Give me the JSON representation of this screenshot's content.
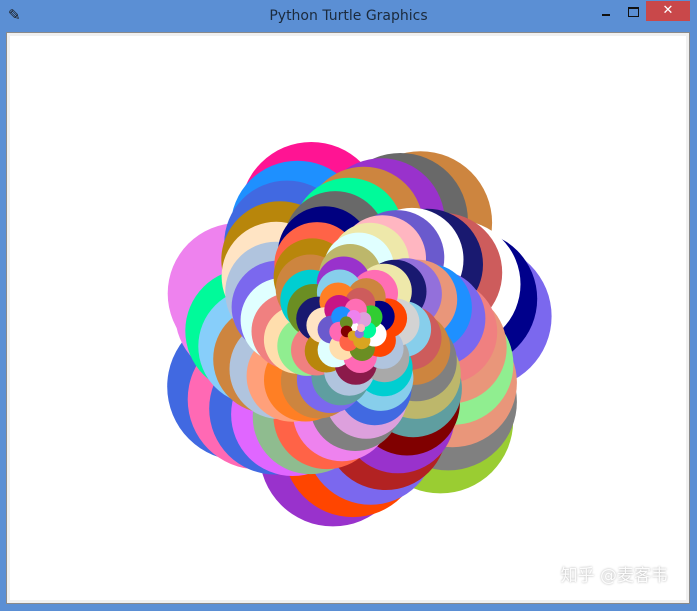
{
  "window": {
    "title": "Python Turtle Graphics",
    "close_glyph": "✕",
    "icons": [
      "feather-icon",
      "minimize-icon",
      "maximize-icon",
      "close-icon"
    ]
  },
  "canvas": {
    "background": "#ffffff",
    "watermark": "知乎 @麦客韦",
    "palette": [
      "#8b1a4a",
      "#6b8e23",
      "#dda0dd",
      "#e066ff",
      "#ee82ee",
      "#ff7f24",
      "#9acd32",
      "#cd5c5c",
      "#ffb6c1",
      "#ffffff",
      "#00fa9a",
      "#87cefa",
      "#a9a9a9",
      "#ff6347",
      "#7b68ee",
      "#ffdead",
      "#191970",
      "#00008b",
      "#228b22",
      "#f08080",
      "#f5f5f5",
      "#b0c4de",
      "#4682b4",
      "#d3d3d3",
      "#808080",
      "#8fbc8f",
      "#cd853f",
      "#e0ffff",
      "#000080",
      "#4169e1",
      "#ff1493",
      "#00ffff",
      "#800000",
      "#9932cc",
      "#ba55d3",
      "#ff4500",
      "#ffa07a",
      "#f5deb3",
      "#eee8aa",
      "#1e90ff",
      "#e9967a",
      "#ff6eb4",
      "#32cd32",
      "#2f4f4f",
      "#87ceeb",
      "#bdb76b",
      "#696969",
      "#c71585",
      "#8b4513",
      "#daa520",
      "#9370db",
      "#00ced1",
      "#ff69b4",
      "#6a5acd",
      "#deb887",
      "#5f9ea0",
      "#b22222",
      "#b8860b",
      "#90ee90",
      "#ffe4c4"
    ]
  }
}
